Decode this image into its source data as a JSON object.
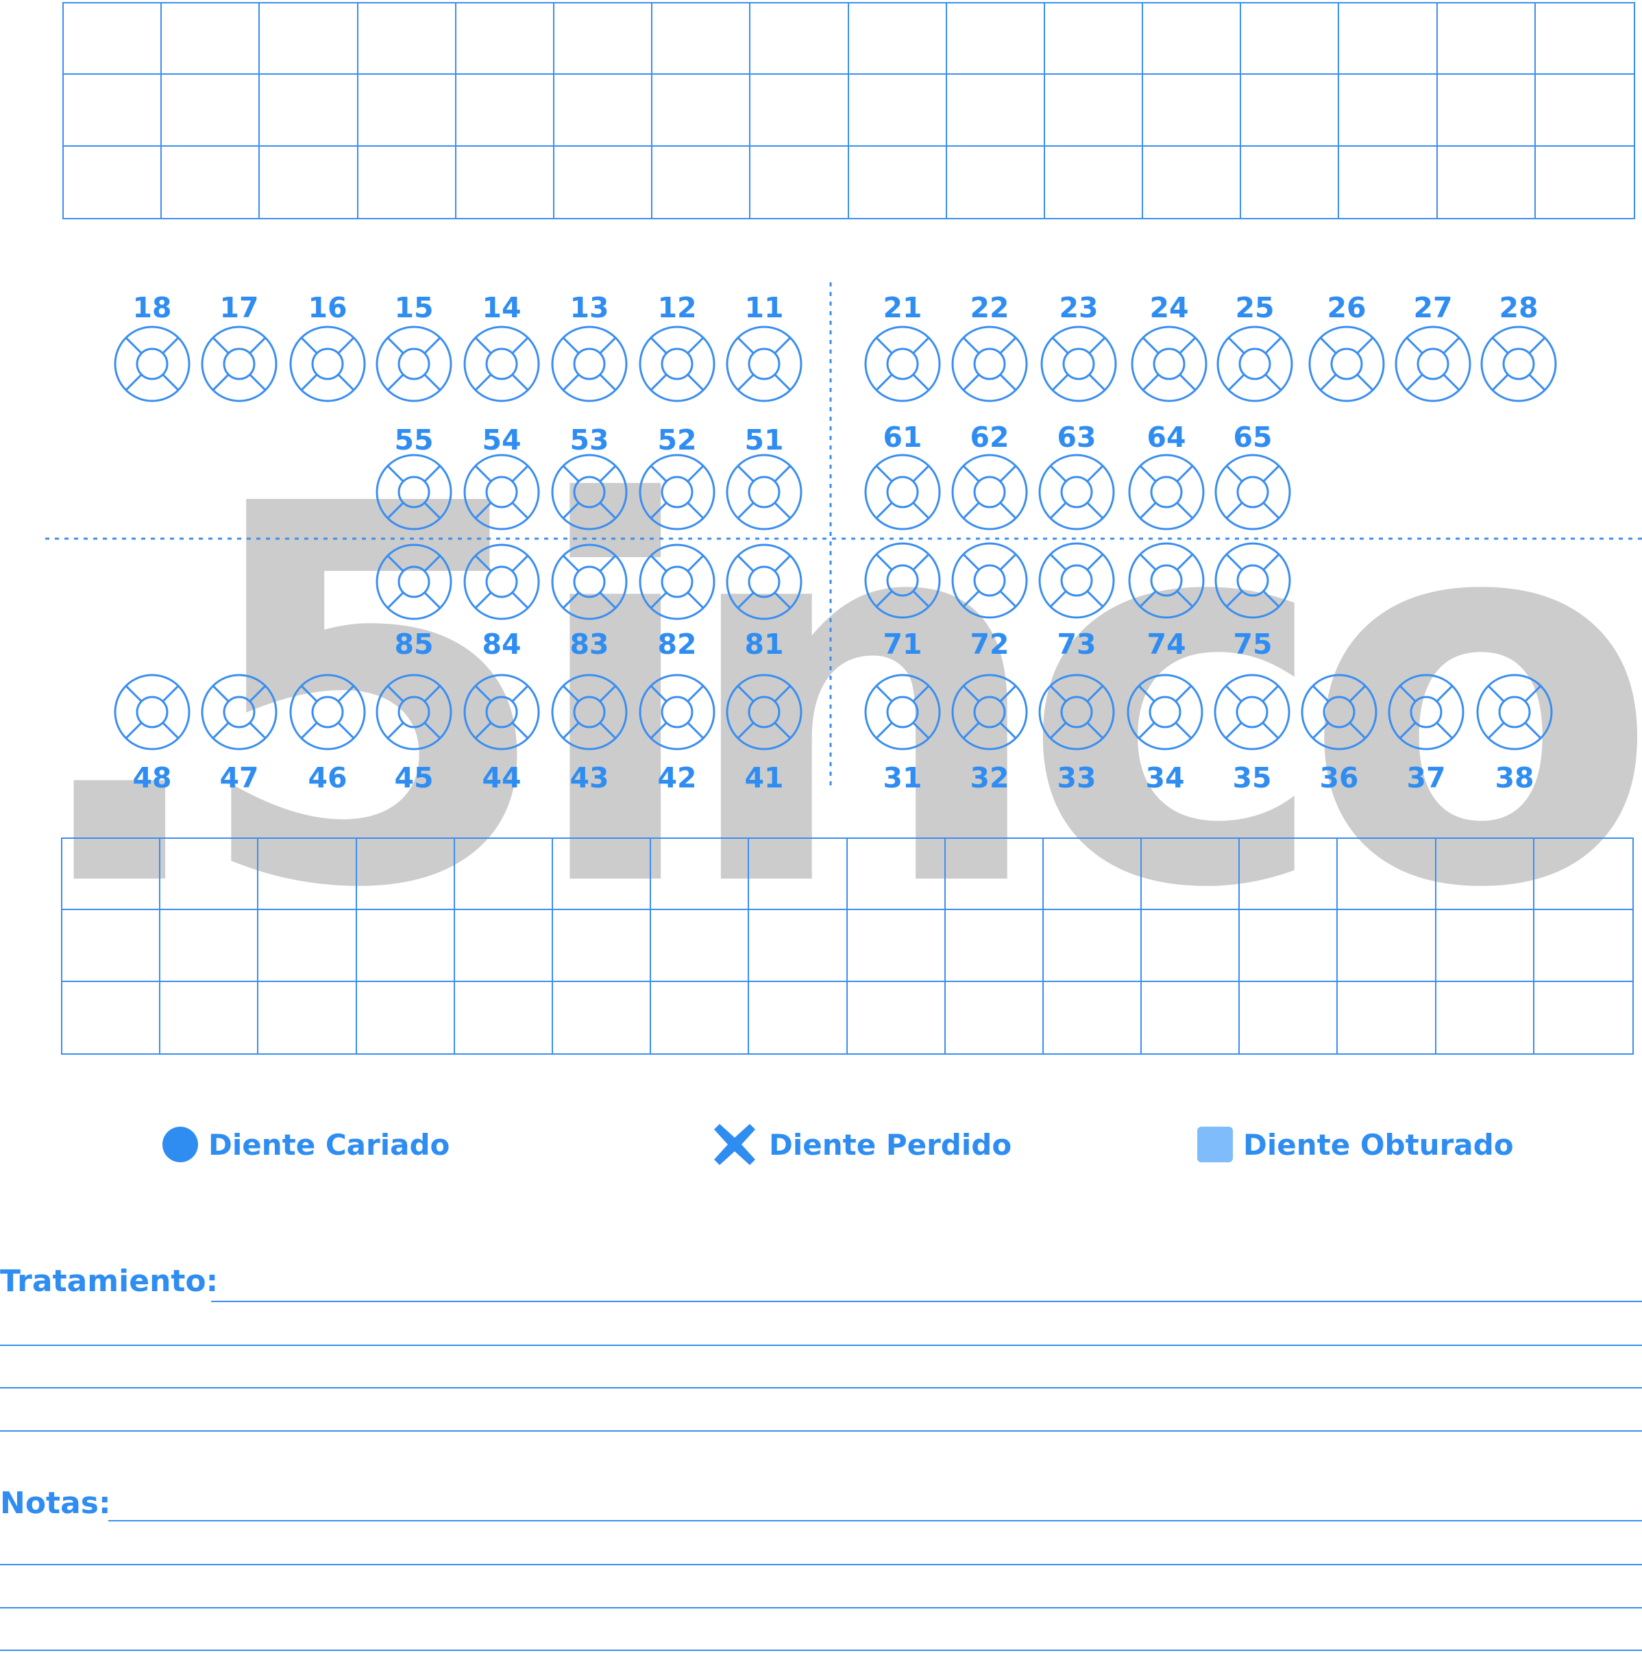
{
  "teeth": {
    "upper_permanent_right": [
      "18",
      "17",
      "16",
      "15",
      "14",
      "13",
      "12",
      "11"
    ],
    "upper_permanent_left": [
      "21",
      "22",
      "23",
      "24",
      "25",
      "26",
      "27",
      "28"
    ],
    "upper_primary_right": [
      "55",
      "54",
      "53",
      "52",
      "51"
    ],
    "upper_primary_left": [
      "61",
      "62",
      "63",
      "64",
      "65"
    ],
    "lower_primary_right": [
      "85",
      "84",
      "83",
      "82",
      "81"
    ],
    "lower_primary_left": [
      "71",
      "72",
      "73",
      "74",
      "75"
    ],
    "lower_permanent_right": [
      "48",
      "47",
      "46",
      "45",
      "44",
      "43",
      "42",
      "41"
    ],
    "lower_permanent_left": [
      "31",
      "32",
      "33",
      "34",
      "35",
      "36",
      "37",
      "38"
    ]
  },
  "legend": {
    "caries": {
      "label": "Diente Cariado",
      "icon": "filled-circle-icon",
      "color": "#2f8df2"
    },
    "missing": {
      "label": "Diente Perdido",
      "icon": "cross-icon",
      "color": "#2f8df2"
    },
    "filled": {
      "label": "Diente Obturado",
      "icon": "light-square-icon",
      "color": "#7fbcfb"
    }
  },
  "form": {
    "treatment_label": "Tratamiento:",
    "notes_label": "Notas:"
  },
  "watermark": ".5inco",
  "colors": {
    "line": "#3a8ef0",
    "text": "#2f8df2",
    "watermark": "#cccccc"
  }
}
